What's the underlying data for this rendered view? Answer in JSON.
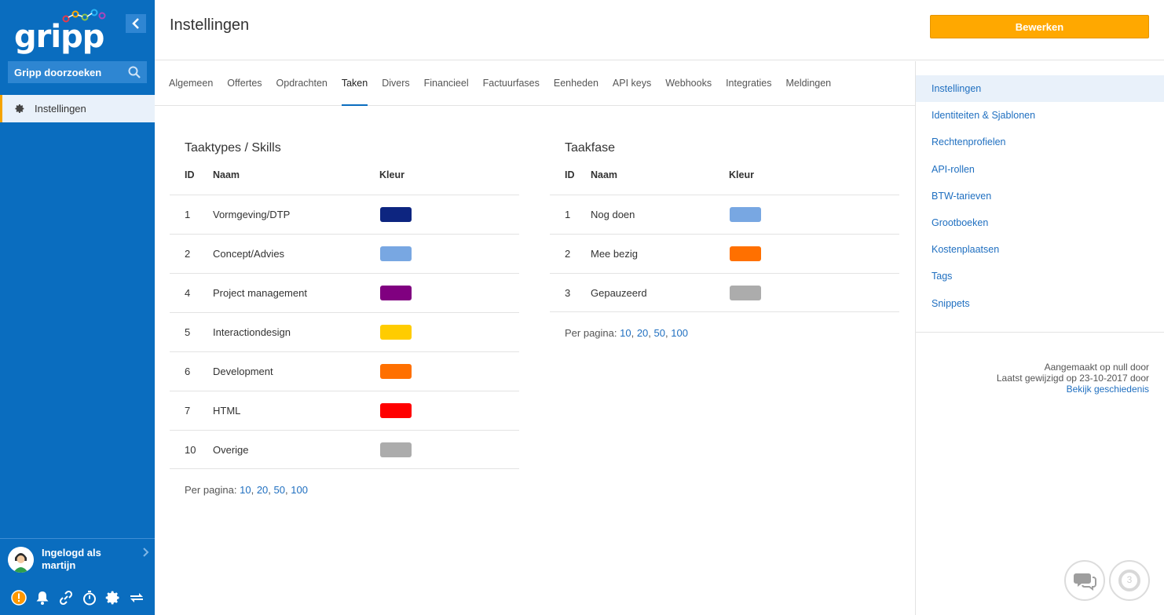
{
  "sidebar": {
    "logo_text": "gripp",
    "search_label": "Gripp doorzoeken",
    "nav_item_label": "Instellingen",
    "user_line1": "Ingelogd als",
    "user_line2": "martijn",
    "bottom_icons": [
      "alert-icon",
      "bell-icon",
      "link-icon",
      "timer-icon",
      "gear-icon",
      "swap-icon"
    ]
  },
  "header": {
    "title": "Instellingen",
    "edit_label": "Bewerken"
  },
  "tabs": [
    "Algemeen",
    "Offertes",
    "Opdrachten",
    "Taken",
    "Divers",
    "Financieel",
    "Factuurfases",
    "Eenheden",
    "API keys",
    "Webhooks",
    "Integraties",
    "Meldingen"
  ],
  "active_tab": "Taken",
  "tasktypes": {
    "title": "Taaktypes / Skills",
    "columns": [
      "ID",
      "Naam",
      "Kleur"
    ],
    "rows": [
      {
        "id": "1",
        "name": "Vormgeving/DTP",
        "color": "#0d2580"
      },
      {
        "id": "2",
        "name": "Concept/Advies",
        "color": "#78a7e2"
      },
      {
        "id": "4",
        "name": "Project management",
        "color": "#800080"
      },
      {
        "id": "5",
        "name": "Interactiondesign",
        "color": "#ffcc00"
      },
      {
        "id": "6",
        "name": "Development",
        "color": "#ff7000"
      },
      {
        "id": "7",
        "name": "HTML",
        "color": "#ff0000"
      },
      {
        "id": "10",
        "name": "Overige",
        "color": "#acacac"
      }
    ],
    "per_page_label": "Per pagina:",
    "per_page_options": [
      "10",
      "20",
      "50",
      "100"
    ]
  },
  "taskphase": {
    "title": "Taakfase",
    "columns": [
      "ID",
      "Naam",
      "Kleur"
    ],
    "rows": [
      {
        "id": "1",
        "name": "Nog doen",
        "color": "#78a7e2"
      },
      {
        "id": "2",
        "name": "Mee bezig",
        "color": "#ff7000"
      },
      {
        "id": "3",
        "name": "Gepauzeerd",
        "color": "#acacac"
      }
    ],
    "per_page_label": "Per pagina:",
    "per_page_options": [
      "10",
      "20",
      "50",
      "100"
    ]
  },
  "rightpanel": {
    "items": [
      "Instellingen",
      "Identiteiten & Sjablonen",
      "Rechtenprofielen",
      "API-rollen",
      "BTW-tarieven",
      "Grootboeken",
      "Kostenplaatsen",
      "Tags",
      "Snippets"
    ],
    "active_item": "Instellingen",
    "meta_created": "Aangemaakt op null door",
    "meta_modified": "Laatst gewijzigd op 23-10-2017 door",
    "meta_history_link": "Bekijk geschiedenis"
  },
  "floating": {
    "notification_count": "3"
  },
  "colors": {
    "sidebar_bg": "#0a6dbf",
    "accent": "#ffa800",
    "link": "#1f6fc0"
  }
}
